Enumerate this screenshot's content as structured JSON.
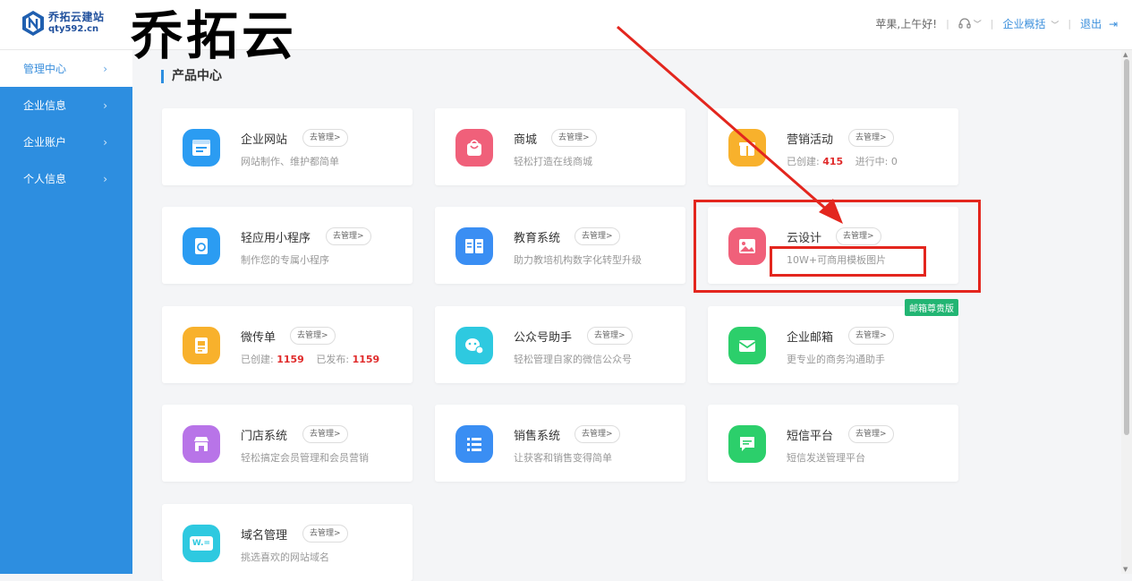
{
  "overlay_title": "乔拓云",
  "logo": {
    "name": "乔拓云建站",
    "domain": "qty592.cn"
  },
  "header": {
    "greeting": "苹果,上午好!",
    "overview": "企业概括",
    "logout": "退出"
  },
  "sidebar": {
    "items": [
      {
        "label": "管理中心",
        "active": true
      },
      {
        "label": "企业信息"
      },
      {
        "label": "企业账户"
      },
      {
        "label": "个人信息"
      }
    ]
  },
  "section_title": "产品中心",
  "manage_label": "去管理>",
  "badge": "邮箱尊贵版",
  "cards": [
    {
      "title": "企业网站",
      "desc": "网站制作、维护都简单",
      "icon": "website-icon",
      "color": "#2b9cf2"
    },
    {
      "title": "商城",
      "desc": "轻松打造在线商城",
      "icon": "shopping-bag-icon",
      "color": "#f0607a"
    },
    {
      "title": "营销活动",
      "desc_created_label": "已创建:",
      "desc_created_value": "415",
      "desc_active_label": "进行中:",
      "desc_active_value": "0",
      "icon": "gift-icon",
      "color": "#f8b12c"
    },
    {
      "title": "轻应用小程序",
      "desc": "制作您的专属小程序",
      "icon": "mini-program-icon",
      "color": "#2b9cf2"
    },
    {
      "title": "教育系统",
      "desc": "助力教培机构数字化转型升级",
      "icon": "book-icon",
      "color": "#3a8ef3"
    },
    {
      "title": "云设计",
      "desc": "10W+可商用模板图片",
      "icon": "image-icon",
      "color": "#f0607a"
    },
    {
      "title": "微传单",
      "desc_created_label": "已创建:",
      "desc_created_value": "1159",
      "desc_published_label": "已发布:",
      "desc_published_value": "1159",
      "icon": "flyer-icon",
      "color": "#f8b12c"
    },
    {
      "title": "公众号助手",
      "desc": "轻松管理自家的微信公众号",
      "icon": "wechat-icon",
      "color": "#2ec9e0"
    },
    {
      "title": "企业邮箱",
      "desc": "更专业的商务沟通助手",
      "icon": "mail-icon",
      "color": "#2ccf6b"
    },
    {
      "title": "门店系统",
      "desc": "轻松搞定会员管理和会员营销",
      "icon": "store-icon",
      "color": "#b874e8"
    },
    {
      "title": "销售系统",
      "desc": "让获客和销售变得简单",
      "icon": "list-icon",
      "color": "#3a8ef3"
    },
    {
      "title": "短信平台",
      "desc": "短信发送管理平台",
      "icon": "sms-icon",
      "color": "#2ccf6b"
    },
    {
      "title": "域名管理",
      "desc": "挑选喜欢的网站域名",
      "icon": "domain-icon",
      "icon_text": "W.=",
      "color": "#2ec9e0"
    }
  ]
}
